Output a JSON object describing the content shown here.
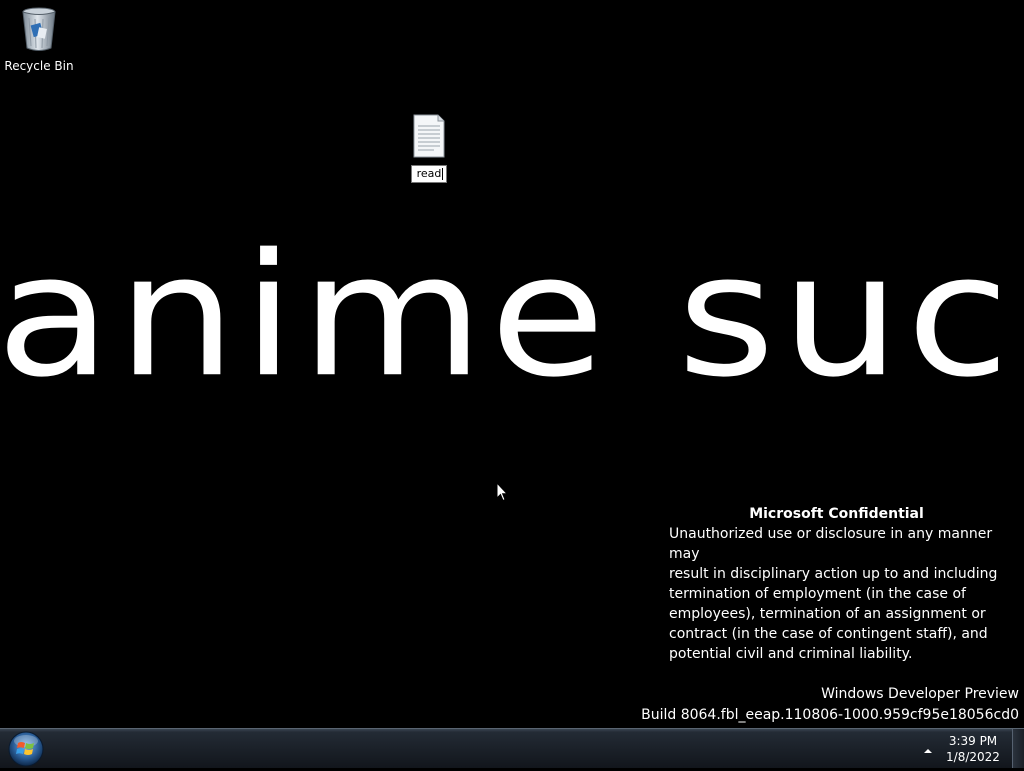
{
  "desktop": {
    "icons": [
      {
        "label": "Recycle Bin",
        "icon": "recycle-bin-icon"
      },
      {
        "label": "read",
        "icon": "text-document-icon",
        "renaming": true
      }
    ],
    "wallpaper_text": "anime sucks",
    "confidential": {
      "title": "Microsoft Confidential",
      "lines": [
        "Unauthorized use or disclosure in any manner may",
        "result in disciplinary action up to and including",
        "termination of employment (in the case of",
        "employees), termination of an assignment or",
        "contract (in the case of contingent staff), and",
        "potential civil and criminal liability."
      ]
    },
    "build": {
      "edition": "Windows Developer Preview",
      "build_string": "Build 8064.fbl_eeap.110806-1000.959cf95e18056cd0"
    }
  },
  "taskbar": {
    "start_icon": "windows-logo-icon",
    "tray_chevron_icon": "chevron-up-icon",
    "clock": {
      "time": "3:39 PM",
      "date": "1/8/2022"
    }
  },
  "colors": {
    "background": "#000000",
    "taskbar": "#1b2129",
    "text": "#ffffff"
  }
}
